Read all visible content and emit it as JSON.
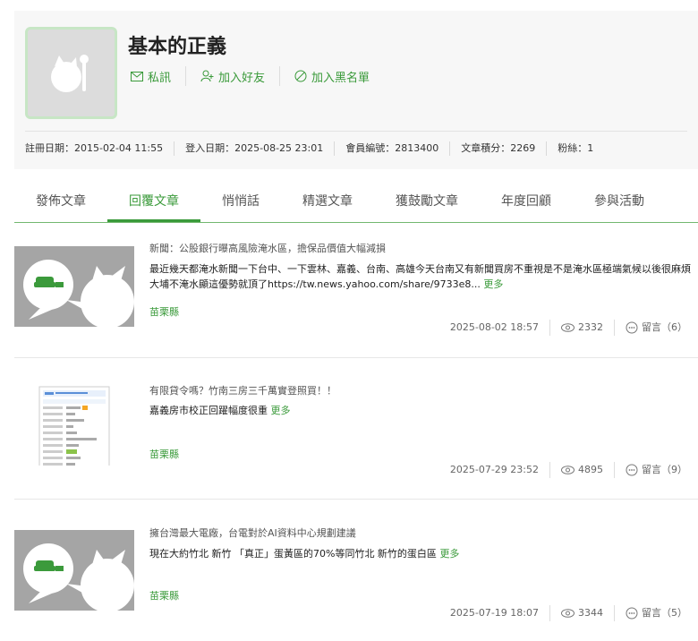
{
  "profile": {
    "username": "基本的正義",
    "actions": [
      {
        "label": "私訊",
        "icon": "mail-icon"
      },
      {
        "label": "加入好友",
        "icon": "add-friend-icon"
      },
      {
        "label": "加入黑名單",
        "icon": "block-icon"
      }
    ],
    "stats": [
      "註冊日期：2015-02-04 11:55",
      "登入日期：2025-08-25 23:01",
      "會員編號：2813400",
      "文章積分：2269",
      "粉絲：1"
    ]
  },
  "tabs": [
    "發佈文章",
    "回覆文章",
    "悄悄話",
    "精選文章",
    "獲鼓勵文章",
    "年度回顧",
    "參與活動"
  ],
  "active_tab": "回覆文章",
  "posts": [
    {
      "title": "新聞：公股銀行曝高風險淹水區，擔保品價值大幅減損",
      "excerpt": "最近幾天都淹水新聞一下台中、一下雲林、嘉義、台南、高雄今天台南又有新聞買房不重視是不是淹水區極端氣候以後很麻煩大埔不淹水顯這優勢就頂了https://tw.news.yahoo.com/share/9733e8...",
      "more": "更多",
      "location": "苗栗縣",
      "date": "2025-08-02 18:57",
      "views": "2332",
      "comments": "留言（6）"
    },
    {
      "title": "有限貸令嗎？竹南三房三千萬實登照買！！",
      "excerpt": "嘉義房市校正回躍幅度很重",
      "more": "更多",
      "location": "苗栗縣",
      "date": "2025-07-29 23:52",
      "views": "4895",
      "comments": "留言（9）"
    },
    {
      "title": "擁台灣最大電廠，台電對於AI資料中心規劃建議",
      "excerpt": "現在大約竹北 新竹 「真正」蛋黃區的70%等同竹北 新竹的蛋白區",
      "more": "更多",
      "location": "苗栗縣",
      "date": "2025-07-19 18:07",
      "views": "3344",
      "comments": "留言（5）"
    }
  ]
}
